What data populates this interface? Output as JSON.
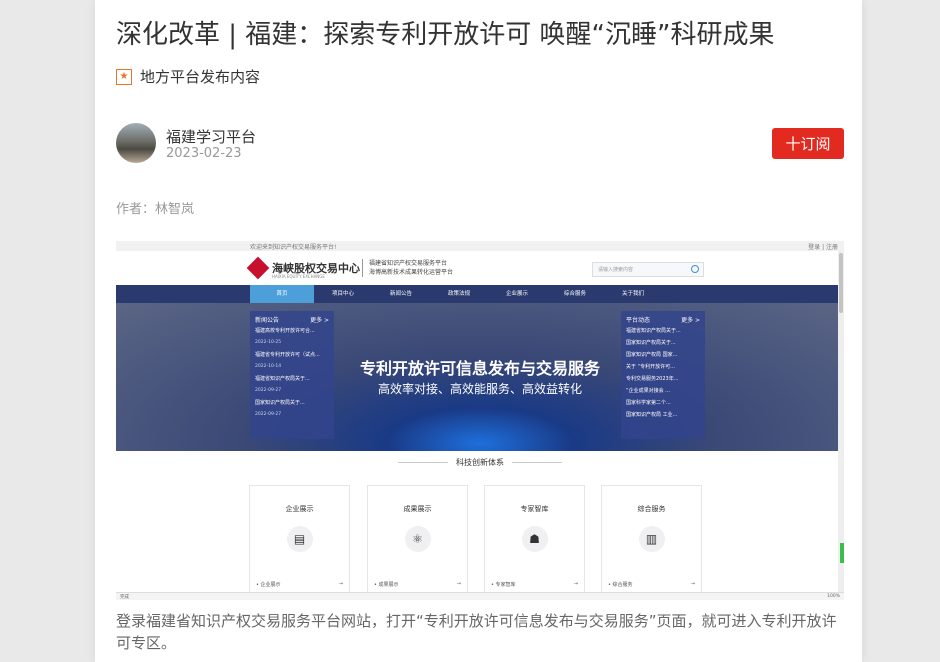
{
  "article": {
    "title": "深化改革 | 福建：探索专利开放许可 唤醒“沉睡”科研成果",
    "source_label": "地方平台发布内容",
    "author_name": "福建学习平台",
    "date": "2023-02-23",
    "subscribe_label": "十订阅",
    "byline": "作者：林智岚",
    "caption": "登录福建省知识产权交易服务平台网站，打开“专利开放许可信息发布与交易服务”页面，就可进入专利开放许可专区。",
    "icons": {
      "source": "star-badge-icon",
      "subscribe": "plus-icon"
    },
    "colors": {
      "subscribe_button": "#e32a21",
      "source_icon": "#e8742a"
    }
  },
  "embedded": {
    "topbar_left": "欢迎来到知识产权交易服务平台!",
    "topbar_right": "登录 | 注册",
    "logo_text": "海峡股权交易中心",
    "logo_sub": "HAIXIA EQUITY EXCHANGE",
    "slogan_1": "福建省知识产权交易服务平台",
    "slogan_2": "海博高新技术成果转化运营平台",
    "search_placeholder": "请输入搜索内容",
    "nav": [
      "首页",
      "项目中心",
      "新闻公告",
      "政策法规",
      "企业展示",
      "综合服务",
      "关于我们"
    ],
    "left_panel": {
      "title": "新闻公告",
      "more": "更多 >",
      "items": [
        {
          "text": "福建高校专利开放许可合...",
          "date": "2022-10-25"
        },
        {
          "text": "福建省专利开放许可（试点...",
          "date": "2022-10-14"
        },
        {
          "text": "福建省知识产权局关于...",
          "date": "2022-09-27"
        },
        {
          "text": "国家知识产权局关于...",
          "date": "2022-09-27"
        }
      ]
    },
    "right_panel": {
      "title": "平台动态",
      "more": "更多 >",
      "items": [
        "福建省知识产权局关于...",
        "国家知识产权局关于...",
        "国家知识产权局 国家...",
        "关于 “专利开放许可...",
        "专利交易服务2023年...",
        "“企业成果对接会 ...",
        "国家科学家第二个...",
        "国家知识产权局 工业..."
      ]
    },
    "banner_title": "专利开放许可信息发布与交易服务",
    "banner_subtitle": "高效率对接、高效能服务、高效益转化",
    "section_title": "科技创新体系",
    "cards": [
      {
        "title": "企业展示",
        "icon": "building-icon",
        "footer": "• 企业展示"
      },
      {
        "title": "成果展示",
        "icon": "atom-icon",
        "footer": "• 成果展示"
      },
      {
        "title": "专家智库",
        "icon": "org-chart-icon",
        "footer": "• 专家智库"
      },
      {
        "title": "综合服务",
        "icon": "chart-icon",
        "footer": "• 综合服务"
      }
    ],
    "status_left": "完成",
    "status_right": "100%",
    "colors": {
      "nav": "#2b3a6e",
      "nav_active": "#4c9fd9",
      "logo": "#c8102e"
    }
  }
}
